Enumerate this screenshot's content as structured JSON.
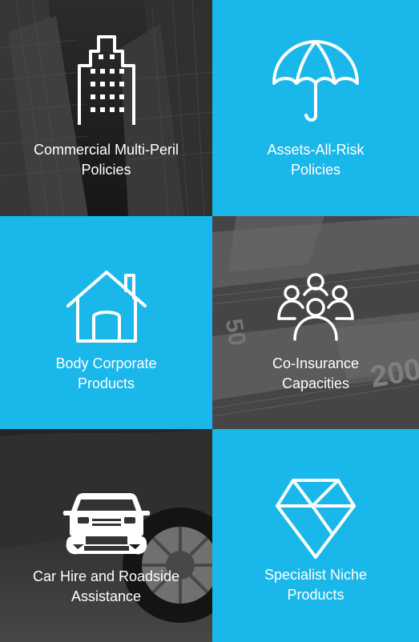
{
  "tiles": [
    {
      "line1": "Commercial Multi-Peril",
      "line2": "Policies",
      "icon": "building-icon",
      "style": "photo-buildings"
    },
    {
      "line1": "Assets-All-Risk",
      "line2": "Policies",
      "icon": "umbrella-icon",
      "style": "blue"
    },
    {
      "line1": "Body Corporate",
      "line2": "Products",
      "icon": "house-icon",
      "style": "blue"
    },
    {
      "line1": "Co-Insurance",
      "line2": "Capacities",
      "icon": "people-group-icon",
      "style": "photo-banknotes"
    },
    {
      "line1": "Car Hire and Roadside",
      "line2": "Assistance",
      "icon": "car-wrench-icon",
      "style": "photo-car"
    },
    {
      "line1": "Specialist Niche",
      "line2": "Products",
      "icon": "diamond-icon",
      "style": "blue"
    }
  ],
  "colors": {
    "accent": "#1ab7ea",
    "text": "#ffffff"
  }
}
